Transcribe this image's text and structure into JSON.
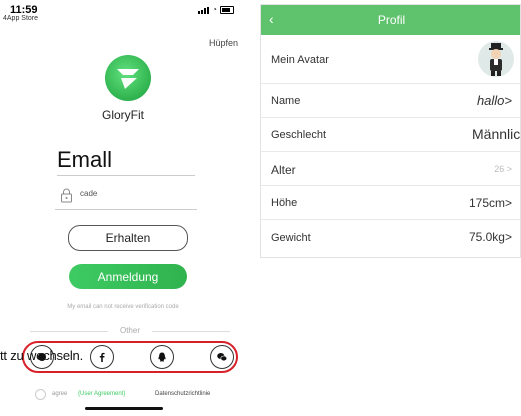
{
  "status_bar": {
    "time": "11:59",
    "carrier": "4App Store"
  },
  "login": {
    "skip_label": "Hüpfen",
    "app_name": "GloryFit",
    "email_label": "Emall",
    "code_value": "cade",
    "get_code_label": "Erhalten",
    "login_label": "Anmeldung",
    "no_code_text": "My email can not receive verification code",
    "other_label": "Other",
    "agree_text": "agree",
    "agreement_link": "{User Agreement}",
    "privacy_link": "Datenschutzrichtlinie",
    "social_icons": [
      "email-icon",
      "facebook-icon",
      "qq-icon",
      "wechat-icon"
    ]
  },
  "annotation": {
    "text": "tt zu wechseln."
  },
  "profile": {
    "back_icon": "back-chevron-icon",
    "title": "Profil",
    "rows": [
      {
        "label": "Mein Avatar",
        "value": ""
      },
      {
        "label": "Name",
        "value": "hallo>"
      },
      {
        "label": "Geschlecht",
        "value": "Männlic"
      },
      {
        "label": "Alter",
        "value": "26 >"
      },
      {
        "label": "Höhe",
        "value": "175cm>"
      },
      {
        "label": "Gewicht",
        "value": "75.0kg>"
      }
    ]
  },
  "colors": {
    "accent_green": "#3ecb63",
    "header_green": "#5fc26d",
    "annotation_red": "#d8202a"
  }
}
